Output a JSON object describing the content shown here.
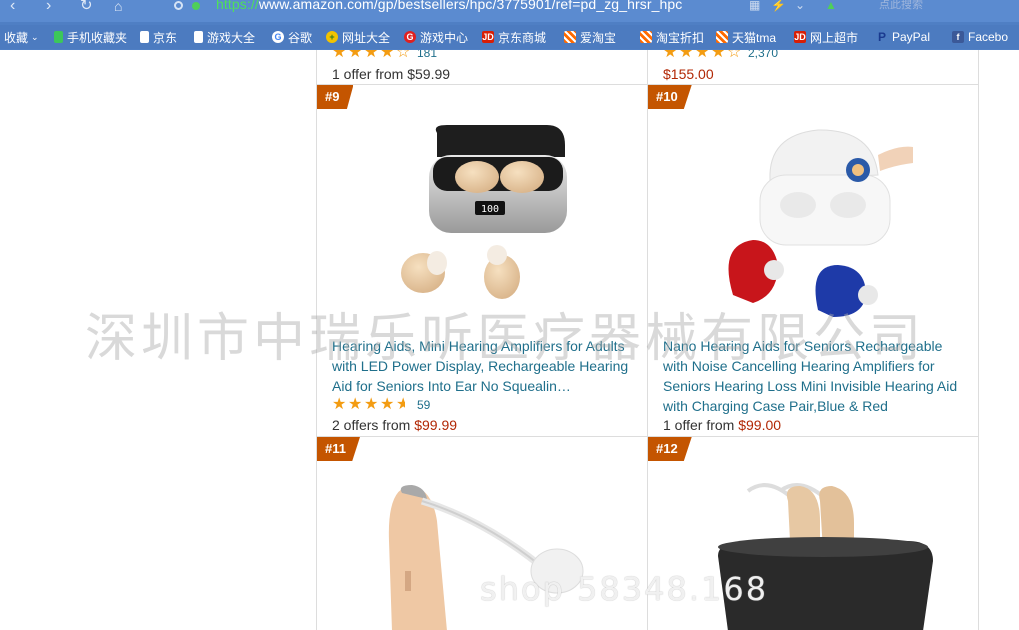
{
  "browser": {
    "url_protocol": "https://",
    "url_rest": "www.amazon.com/gp/bestsellers/hpc/3775901/ref=pd_zg_hrsr_hpc",
    "search_placeholder": "点此搜索"
  },
  "bookmarks": [
    {
      "label": "收藏",
      "icon": "star-icon"
    },
    {
      "label": "手机收藏夹",
      "icon": "phone-icon",
      "color": "#3cc75a"
    },
    {
      "label": "京东",
      "icon": "page-icon",
      "color": "#ffffff"
    },
    {
      "label": "游戏大全",
      "icon": "page-icon",
      "color": "#ffffff"
    },
    {
      "label": "谷歌",
      "icon": "google-icon"
    },
    {
      "label": "网址大全",
      "icon": "plus-icon",
      "color": "#f2c300"
    },
    {
      "label": "游戏中心",
      "icon": "game-icon",
      "color": "#e02020"
    },
    {
      "label": "京东商城",
      "icon": "jd-icon",
      "color": "#d81e06"
    },
    {
      "label": "爱淘宝",
      "icon": "grid-icon",
      "color": "#ff6a00"
    },
    {
      "label": "淘宝折扣",
      "icon": "grid-icon",
      "color": "#ff6a00"
    },
    {
      "label": "天猫tma",
      "icon": "grid-icon",
      "color": "#ff6a00"
    },
    {
      "label": "网上超市",
      "icon": "jd-icon",
      "color": "#d81e06"
    },
    {
      "label": "PayPal",
      "icon": "paypal-icon",
      "color": "#1a3a8f"
    },
    {
      "label": "Facebo",
      "icon": "facebook-icon",
      "color": "#3b5998"
    }
  ],
  "products": {
    "top_left": {
      "rating_count": "181",
      "offer_prefix": "1 offer from ",
      "price": "$59.99",
      "rating": 4.0
    },
    "top_right": {
      "rating_count": "2,370",
      "price": "$155.00",
      "rating": 4.0
    },
    "p9": {
      "rank": "#9",
      "title": "Hearing Aids, Mini Hearing Amplifiers for Adults with LED Power Display, Rechargeable Hearing Aid for Seniors Into Ear No Squealin…",
      "rating": 4.5,
      "rating_count": "59",
      "offer_prefix": "2 offers from ",
      "price": "$99.99",
      "display_text": "100"
    },
    "p10": {
      "rank": "#10",
      "title": "Nano Hearing Aids for Seniors Rechargeable with Noise Cancelling Hearing Amplifiers for Seniors Hearing Loss Mini Invisible Hearing Aid with Charging Case Pair,Blue & Red",
      "offer_prefix": "1 offer from ",
      "price": "$99.00"
    },
    "p11": {
      "rank": "#11"
    },
    "p12": {
      "rank": "#12"
    }
  },
  "watermark": {
    "company": "深圳市中瑞乐听医疗器械有限公司",
    "phone_fragment": "shop    58348.168"
  },
  "colors": {
    "rank_badge": "#c45500",
    "link": "#1f6f8b",
    "price": "#b12704",
    "star": "#f39c12",
    "chrome": "#4f7fc4"
  }
}
